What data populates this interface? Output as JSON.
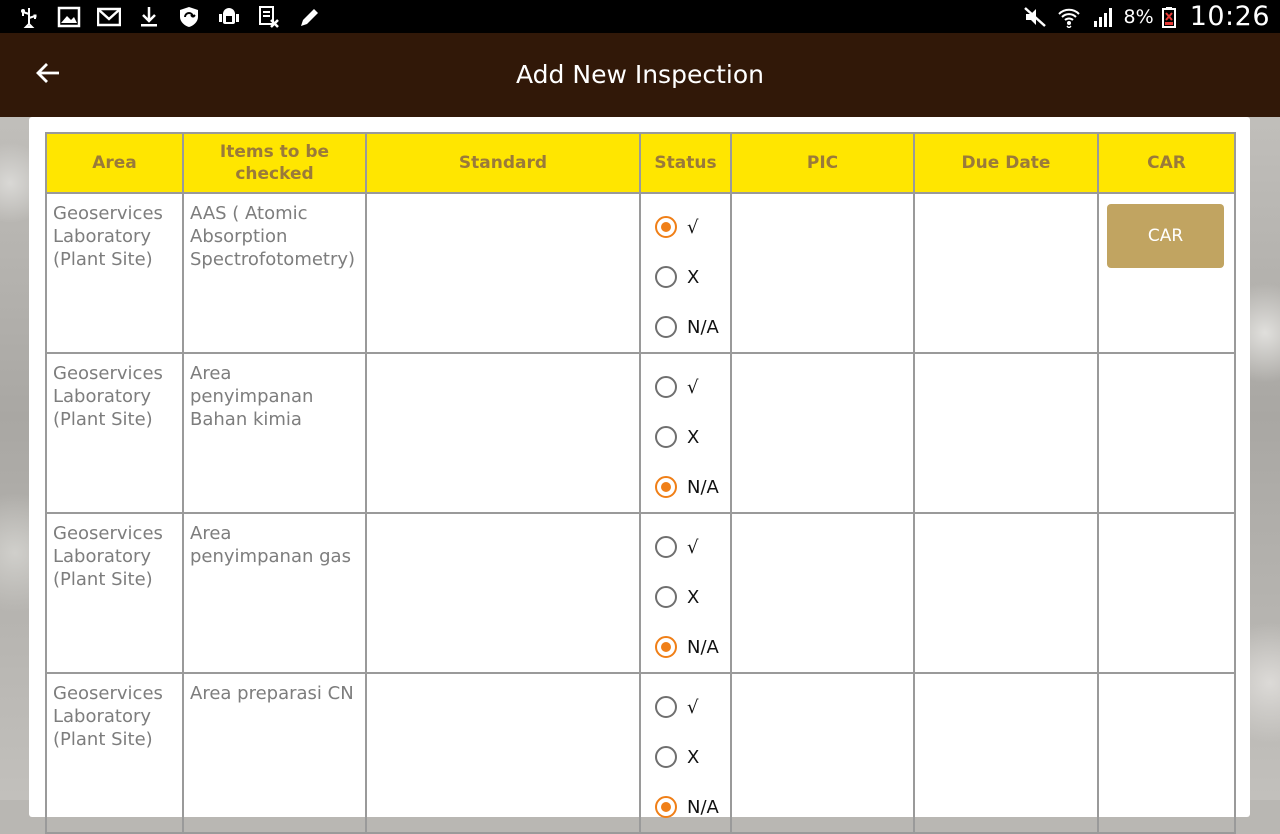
{
  "status_bar": {
    "battery_percent": "8%",
    "time": "10:26",
    "left_icons": [
      "usb-icon",
      "image-icon",
      "gmail-icon",
      "download-icon",
      "shield-sync-icon",
      "android-debug-icon",
      "document-x-icon",
      "pencil-icon"
    ],
    "right_icons": [
      "mute-icon",
      "wifi-icon",
      "signal-icon",
      "battery-low-icon"
    ]
  },
  "header": {
    "title": "Add New Inspection",
    "back_icon": "arrow-left-icon"
  },
  "table": {
    "headers": {
      "area": "Area",
      "items": "Items to be checked",
      "standard": "Standard",
      "status": "Status",
      "pic": "PIC",
      "due_date": "Due Date",
      "car": "CAR"
    },
    "status_options": [
      "√",
      "X",
      "N/A"
    ],
    "rows": [
      {
        "area": "Geoservices Laboratory (Plant Site)",
        "item": "AAS ( Atomic Absorption Spectrofotometry)",
        "standard": "",
        "status": "√",
        "pic": "",
        "due_date": "",
        "car_button": "CAR"
      },
      {
        "area": "Geoservices Laboratory (Plant Site)",
        "item": "Area penyimpanan Bahan kimia",
        "standard": "",
        "status": "N/A",
        "pic": "",
        "due_date": "",
        "car_button": ""
      },
      {
        "area": "Geoservices Laboratory (Plant Site)",
        "item": "Area penyimpanan gas",
        "standard": "",
        "status": "N/A",
        "pic": "",
        "due_date": "",
        "car_button": ""
      },
      {
        "area": "Geoservices Laboratory (Plant Site)",
        "item": "Area preparasi CN",
        "standard": "",
        "status": "N/A",
        "pic": "",
        "due_date": "",
        "car_button": ""
      }
    ]
  },
  "colors": {
    "action_bar": "#311808",
    "header_bg": "#ffe600",
    "header_text": "#9a7a3a",
    "radio_accent": "#f07f17",
    "car_button": "#c1a461"
  }
}
